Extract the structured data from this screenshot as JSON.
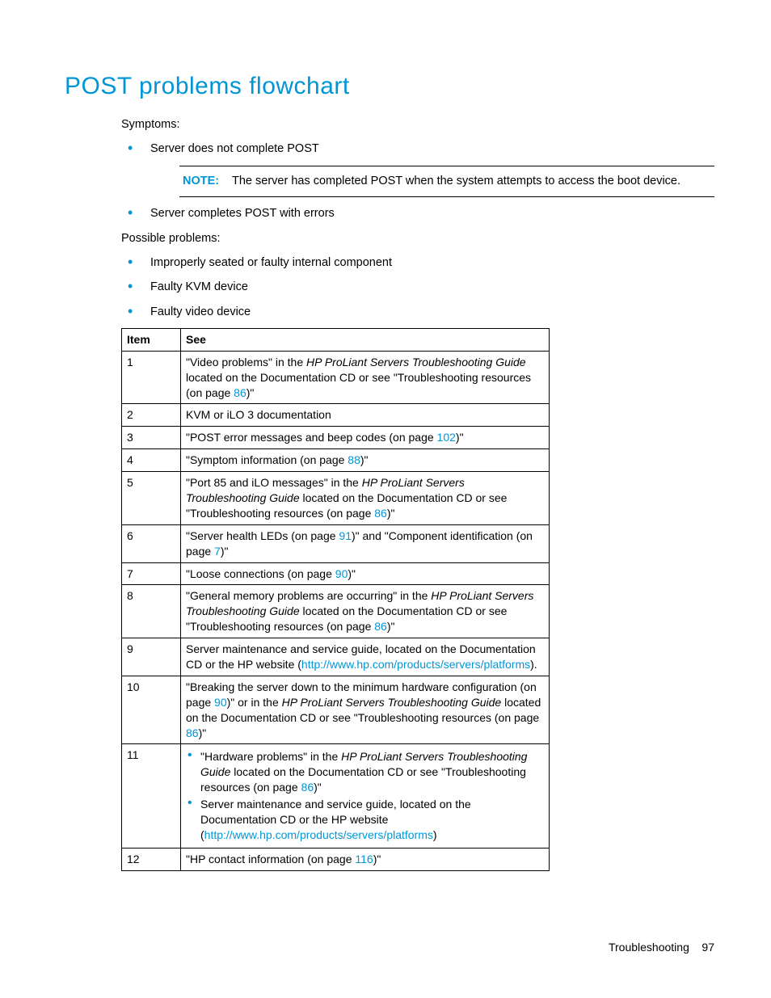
{
  "heading": "POST problems flowchart",
  "symptoms_label": "Symptoms:",
  "symptoms": {
    "item1": "Server does not complete POST",
    "item2": "Server completes POST with errors"
  },
  "note": {
    "label": "NOTE:",
    "text": "The server has completed POST when the system attempts to access the boot device."
  },
  "possible_label": "Possible problems:",
  "possible": {
    "item1": "Improperly seated or faulty internal component",
    "item2": "Faulty KVM device",
    "item3": "Faulty video device"
  },
  "table": {
    "headers": {
      "item": "Item",
      "see": "See"
    },
    "rows": {
      "r1": {
        "num": "1",
        "pre": "\"Video problems\" in the ",
        "italic": "HP ProLiant Servers Troubleshooting Guide",
        "mid": " located on the Documentation CD or see \"Troubleshooting resources (on page ",
        "link": "86",
        "post": ")\""
      },
      "r2": {
        "num": "2",
        "text": "KVM or iLO 3 documentation"
      },
      "r3": {
        "num": "3",
        "pre": "\"POST error messages and beep codes (on page ",
        "link": "102",
        "post": ")\""
      },
      "r4": {
        "num": "4",
        "pre": "\"Symptom information (on page ",
        "link": "88",
        "post": ")\""
      },
      "r5": {
        "num": "5",
        "pre": "\"Port 85 and iLO messages\" in the ",
        "italic": "HP ProLiant Servers Troubleshooting Guide",
        "mid": " located on the Documentation CD or see \"Troubleshooting resources (on page ",
        "link": "86",
        "post": ")\""
      },
      "r6": {
        "num": "6",
        "pre": "\"Server health LEDs (on page ",
        "link1": "91",
        "mid": ")\" and \"Component identification (on page ",
        "link2": "7",
        "post": ")\""
      },
      "r7": {
        "num": "7",
        "pre": "\"Loose connections (on page ",
        "link": "90",
        "post": ")\""
      },
      "r8": {
        "num": "8",
        "pre": "\"General memory problems are occurring\" in the ",
        "italic": "HP ProLiant Servers Troubleshooting Guide",
        "mid": " located on the Documentation CD or see \"Troubleshooting resources (on page ",
        "link": "86",
        "post": ")\""
      },
      "r9": {
        "num": "9",
        "pre": "Server maintenance and service guide, located on the Documentation CD or the HP website (",
        "link": "http://www.hp.com/products/servers/platforms",
        "post": ")."
      },
      "r10": {
        "num": "10",
        "pre": "\"Breaking the server down to the minimum hardware configuration (on page ",
        "link1": "90",
        "mid1": ")\" or in the ",
        "italic": "HP ProLiant Servers Troubleshooting Guide",
        "mid2": " located on the Documentation CD or see \"Troubleshooting resources (on page ",
        "link2": "86",
        "post": ")\""
      },
      "r11": {
        "num": "11",
        "b1_pre": "\"Hardware problems\" in the ",
        "b1_italic": "HP ProLiant Servers Troubleshooting Guide",
        "b1_mid": " located on the Documentation CD or see \"Troubleshooting resources (on page ",
        "b1_link": "86",
        "b1_post": ")\"",
        "b2_pre": "Server maintenance and service guide, located on the Documentation CD or the HP website (",
        "b2_link": "http://www.hp.com/products/servers/platforms",
        "b2_post": ")"
      },
      "r12": {
        "num": "12",
        "pre": "\"HP contact information (on page ",
        "link": "116",
        "post": ")\""
      }
    }
  },
  "footer": {
    "section": "Troubleshooting",
    "page": "97"
  }
}
